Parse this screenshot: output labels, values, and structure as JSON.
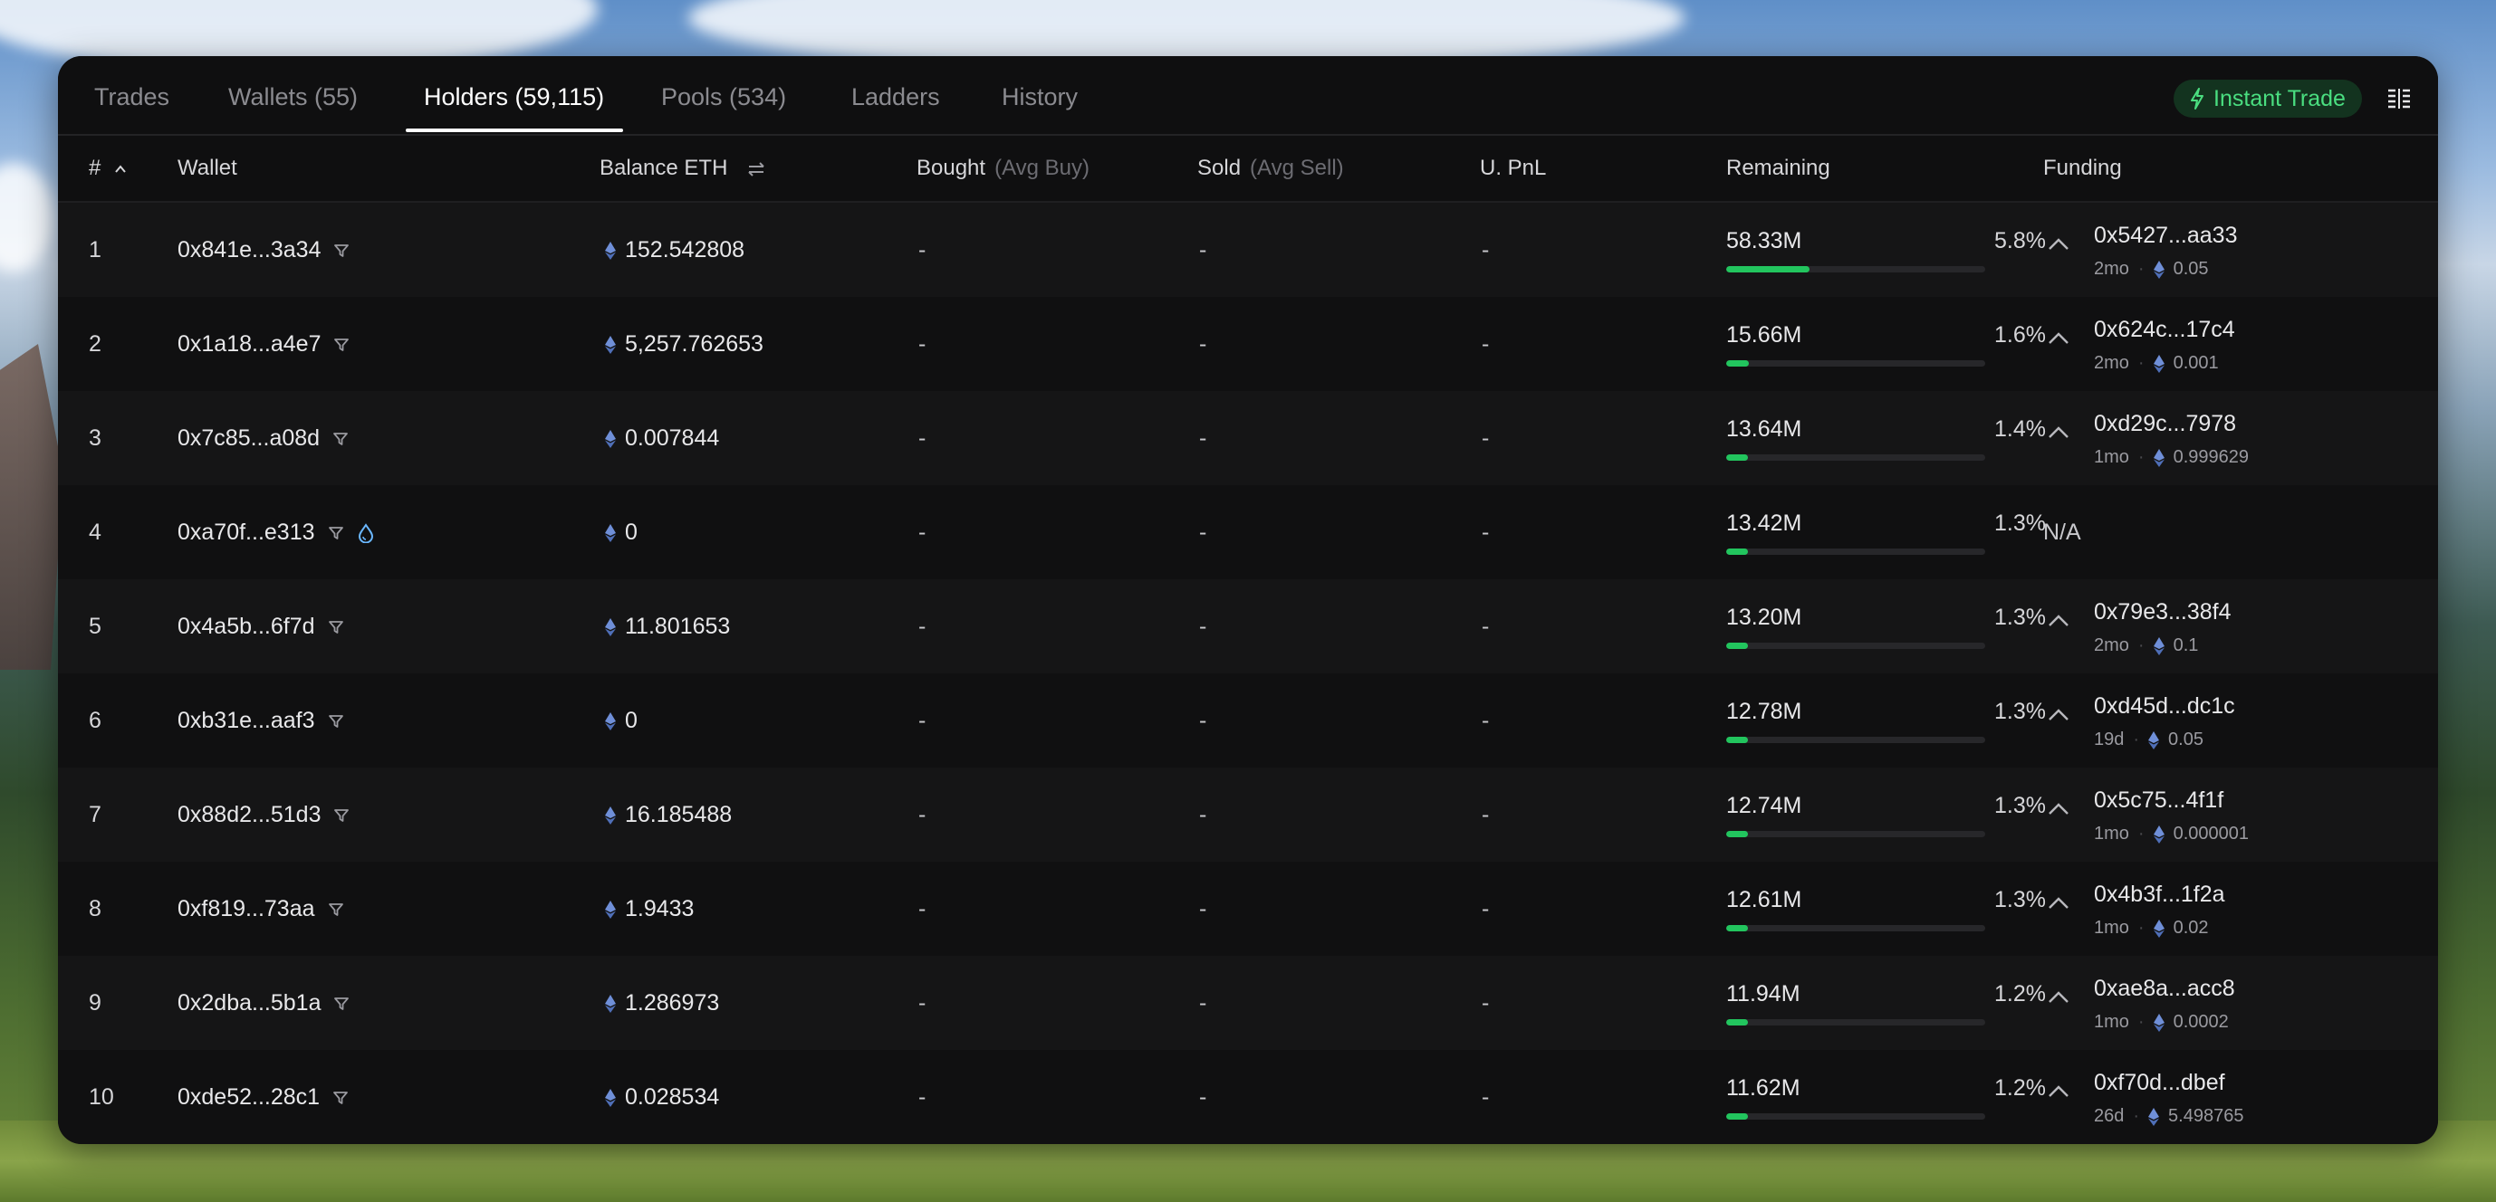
{
  "tabs": [
    {
      "label": "Trades"
    },
    {
      "label": "Wallets (55)"
    },
    {
      "label": "Holders (59,115)"
    },
    {
      "label": "Pools (534)"
    },
    {
      "label": "Ladders"
    },
    {
      "label": "History"
    }
  ],
  "active_tab": "Holders (59,115)",
  "instant_trade_label": "Instant Trade",
  "columns": {
    "rank": "#",
    "wallet": "Wallet",
    "balance": "Balance ETH",
    "bought": "Bought",
    "bought_sub": "(Avg Buy)",
    "sold": "Sold",
    "sold_sub": "(Avg Sell)",
    "upnl": "U. PnL",
    "remaining": "Remaining",
    "funding": "Funding"
  },
  "rows": [
    {
      "rank": "1",
      "wallet": "0x841e...3a34",
      "balance": "152.542808",
      "bought": "-",
      "sold": "-",
      "upnl": "-",
      "remaining": "58.33M",
      "pct": "5.8%",
      "fill": 5.8,
      "funding": {
        "addr": "0x5427...aa33",
        "age": "2mo",
        "amount": "0.05"
      }
    },
    {
      "rank": "2",
      "wallet": "0x1a18...a4e7",
      "balance": "5,257.762653",
      "bought": "-",
      "sold": "-",
      "upnl": "-",
      "remaining": "15.66M",
      "pct": "1.6%",
      "fill": 1.6,
      "funding": {
        "addr": "0x624c...17c4",
        "age": "2mo",
        "amount": "0.001"
      }
    },
    {
      "rank": "3",
      "wallet": "0x7c85...a08d",
      "balance": "0.007844",
      "bought": "-",
      "sold": "-",
      "upnl": "-",
      "remaining": "13.64M",
      "pct": "1.4%",
      "fill": 1.4,
      "funding": {
        "addr": "0xd29c...7978",
        "age": "1mo",
        "amount": "0.999629"
      }
    },
    {
      "rank": "4",
      "wallet": "0xa70f...e313",
      "balance": "0",
      "bought": "-",
      "sold": "-",
      "upnl": "-",
      "remaining": "13.42M",
      "pct": "1.3%",
      "fill": 1.3,
      "liquidity_icon": "droplet-icon",
      "funding_text": "N/A"
    },
    {
      "rank": "5",
      "wallet": "0x4a5b...6f7d",
      "balance": "11.801653",
      "bought": "-",
      "sold": "-",
      "upnl": "-",
      "remaining": "13.20M",
      "pct": "1.3%",
      "fill": 1.3,
      "funding": {
        "addr": "0x79e3...38f4",
        "age": "2mo",
        "amount": "0.1"
      }
    },
    {
      "rank": "6",
      "wallet": "0xb31e...aaf3",
      "balance": "0",
      "bought": "-",
      "sold": "-",
      "upnl": "-",
      "remaining": "12.78M",
      "pct": "1.3%",
      "fill": 1.3,
      "funding": {
        "addr": "0xd45d...dc1c",
        "age": "19d",
        "amount": "0.05"
      }
    },
    {
      "rank": "7",
      "wallet": "0x88d2...51d3",
      "balance": "16.185488",
      "bought": "-",
      "sold": "-",
      "upnl": "-",
      "remaining": "12.74M",
      "pct": "1.3%",
      "fill": 1.3,
      "funding": {
        "addr": "0x5c75...4f1f",
        "age": "1mo",
        "amount": "0.000001"
      }
    },
    {
      "rank": "8",
      "wallet": "0xf819...73aa",
      "balance": "1.9433",
      "bought": "-",
      "sold": "-",
      "upnl": "-",
      "remaining": "12.61M",
      "pct": "1.3%",
      "fill": 1.3,
      "funding": {
        "addr": "0x4b3f...1f2a",
        "age": "1mo",
        "amount": "0.02"
      }
    },
    {
      "rank": "9",
      "wallet": "0x2dba...5b1a",
      "balance": "1.286973",
      "bought": "-",
      "sold": "-",
      "upnl": "-",
      "remaining": "11.94M",
      "pct": "1.2%",
      "fill": 1.2,
      "funding": {
        "addr": "0xae8a...acc8",
        "age": "1mo",
        "amount": "0.0002"
      }
    },
    {
      "rank": "10",
      "wallet": "0xde52...28c1",
      "balance": "0.028534",
      "bought": "-",
      "sold": "-",
      "upnl": "-",
      "remaining": "11.62M",
      "pct": "1.2%",
      "fill": 1.2,
      "funding": {
        "addr": "0xf70d...dbef",
        "age": "26d",
        "amount": "5.498765"
      }
    }
  ],
  "colors": {
    "accent_green": "#4ade80",
    "bar_fill": "#22c55e",
    "eth_icon": "#6f8fd8",
    "droplet": "#6ab7ff"
  }
}
